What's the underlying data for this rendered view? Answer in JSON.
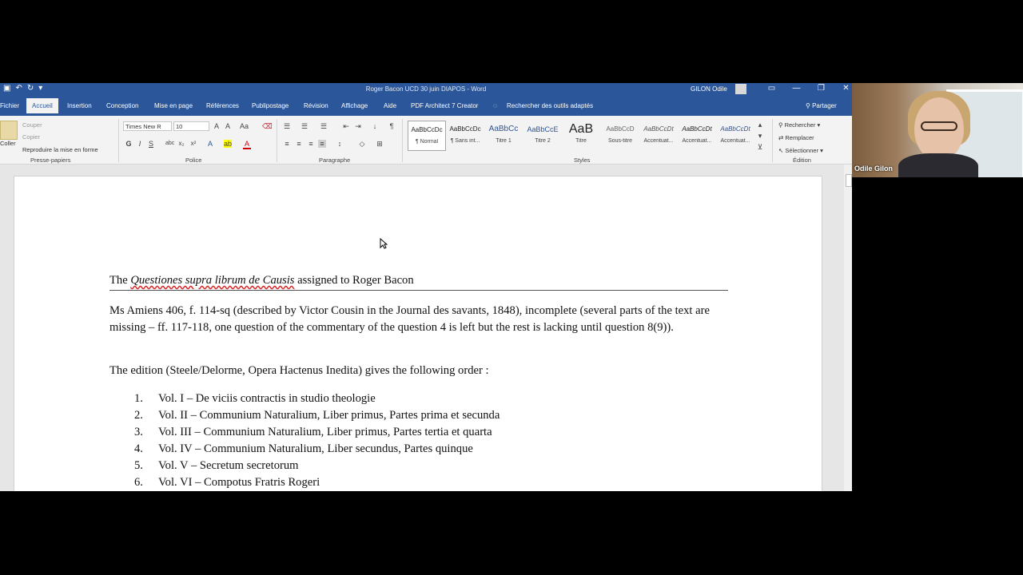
{
  "window": {
    "title": "Roger Bacon UCD 30 juin DIAPOS  -  Word",
    "user": "GILON  Odile",
    "controls": [
      "▭",
      "—",
      "❐",
      "✕"
    ]
  },
  "tabs": [
    {
      "label": "Fichier",
      "active": false
    },
    {
      "label": "Accueil",
      "active": true
    },
    {
      "label": "Insertion",
      "active": false
    },
    {
      "label": "Conception",
      "active": false
    },
    {
      "label": "Mise en page",
      "active": false
    },
    {
      "label": "Références",
      "active": false
    },
    {
      "label": "Publipostage",
      "active": false
    },
    {
      "label": "Révision",
      "active": false
    },
    {
      "label": "Affichage",
      "active": false
    },
    {
      "label": "Aide",
      "active": false
    },
    {
      "label": "PDF Architect 7 Creator",
      "active": false
    },
    {
      "label": "Rechercher des outils adaptés",
      "active": false
    }
  ],
  "share_label": "Partager",
  "clipboard": {
    "paste": "Coller",
    "cut": "Couper",
    "copy": "Copier",
    "format_painter": "Reproduire la mise en forme",
    "group": "Presse-papiers"
  },
  "font": {
    "name": "Times New R",
    "size": "10",
    "group": "Police"
  },
  "paragraph": {
    "group": "Paragraphe"
  },
  "styles": {
    "group": "Styles",
    "items": [
      {
        "sample": "AaBbCcDc",
        "name": "¶ Normal",
        "selected": true
      },
      {
        "sample": "AaBbCcDc",
        "name": "¶ Sans int...",
        "selected": false
      },
      {
        "sample": "AaBbCc",
        "name": "Titre 1",
        "selected": false
      },
      {
        "sample": "AaBbCcE",
        "name": "Titre 2",
        "selected": false
      },
      {
        "sample": "AaB",
        "name": "Titre",
        "selected": false
      },
      {
        "sample": "AaBbCcD",
        "name": "Sous-titre",
        "selected": false
      },
      {
        "sample": "AaBbCcDt",
        "name": "Accentuat...",
        "selected": false
      },
      {
        "sample": "AaBbCcDt",
        "name": "Accentuat...",
        "selected": false
      },
      {
        "sample": "AaBbCcDt",
        "name": "Accentuat...",
        "selected": false
      }
    ]
  },
  "editing": {
    "find": "Rechercher",
    "replace": "Remplacer",
    "select": "Sélectionner",
    "group": "Édition"
  },
  "document": {
    "heading_prefix": "The ",
    "heading_italic": "Questiones supra librum de Causis",
    "heading_suffix": "  assigned to Roger Bacon",
    "para1": "Ms Amiens 406, f. 114-sq (described by Victor Cousin in the Journal des savants, 1848), incomplete (several parts of the text are missing – ff. 117-118, one question of the commentary of the question 4 is left but the rest is lacking until question 8(9)).",
    "para2": "The edition (Steele/Delorme, Opera Hactenus Inedita) gives the following order :",
    "list": [
      {
        "num": "1.",
        "text": "Vol. I – De viciis contractis in studio theologie"
      },
      {
        "num": "2.",
        "text": "Vol. II – Communium Naturalium, Liber primus, Partes prima et secunda"
      },
      {
        "num": "3.",
        "text": "Vol. III – Communium Naturalium, Liber primus, Partes tertia et quarta"
      },
      {
        "num": "4.",
        "text": "Vol. IV – Communium Naturalium, Liber secundus, Partes quinque"
      },
      {
        "num": "5.",
        "text": "Vol. V – Secretum secretorum"
      },
      {
        "num": "6.",
        "text": "Vol. VI – Compotus Fratris Rogeri"
      }
    ]
  },
  "webcam": {
    "name": "Odile Gilon"
  },
  "colors": {
    "accent": "#2b579a",
    "ribbon": "#f3f3f3",
    "doc_bg": "#e6e6e6",
    "spell": "#d22222"
  }
}
